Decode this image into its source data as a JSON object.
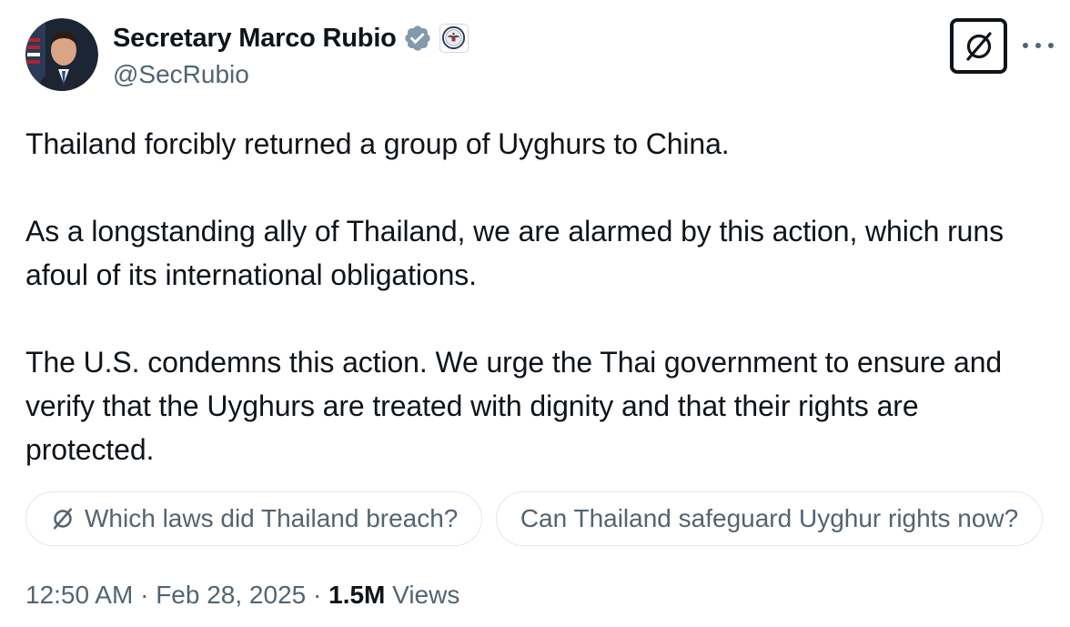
{
  "author": {
    "name": "Secretary Marco Rubio",
    "handle": "@SecRubio",
    "verified_badge_color": "#829aab"
  },
  "tweet": {
    "paragraphs": [
      "Thailand forcibly returned a group of Uyghurs to China.",
      "As a longstanding ally of Thailand, we are alarmed by this action, which runs afoul of its international obligations.",
      "The U.S. condemns this action. We urge the Thai government to ensure and verify that the Uyghurs are treated with dignity and that their rights are protected."
    ]
  },
  "suggestions": [
    {
      "label": "Which laws did Thailand breach?",
      "icon": "grok-icon"
    },
    {
      "label": "Can Thailand safeguard Uyghur rights now?",
      "icon": ""
    }
  ],
  "meta": {
    "time": "12:50 AM",
    "separator": "·",
    "date": "Feb 28, 2025",
    "views_count": "1.5M",
    "views_label": "Views"
  },
  "colors": {
    "text": "#0f1419",
    "secondary": "#536471",
    "chip_border": "#e1e8ed"
  }
}
